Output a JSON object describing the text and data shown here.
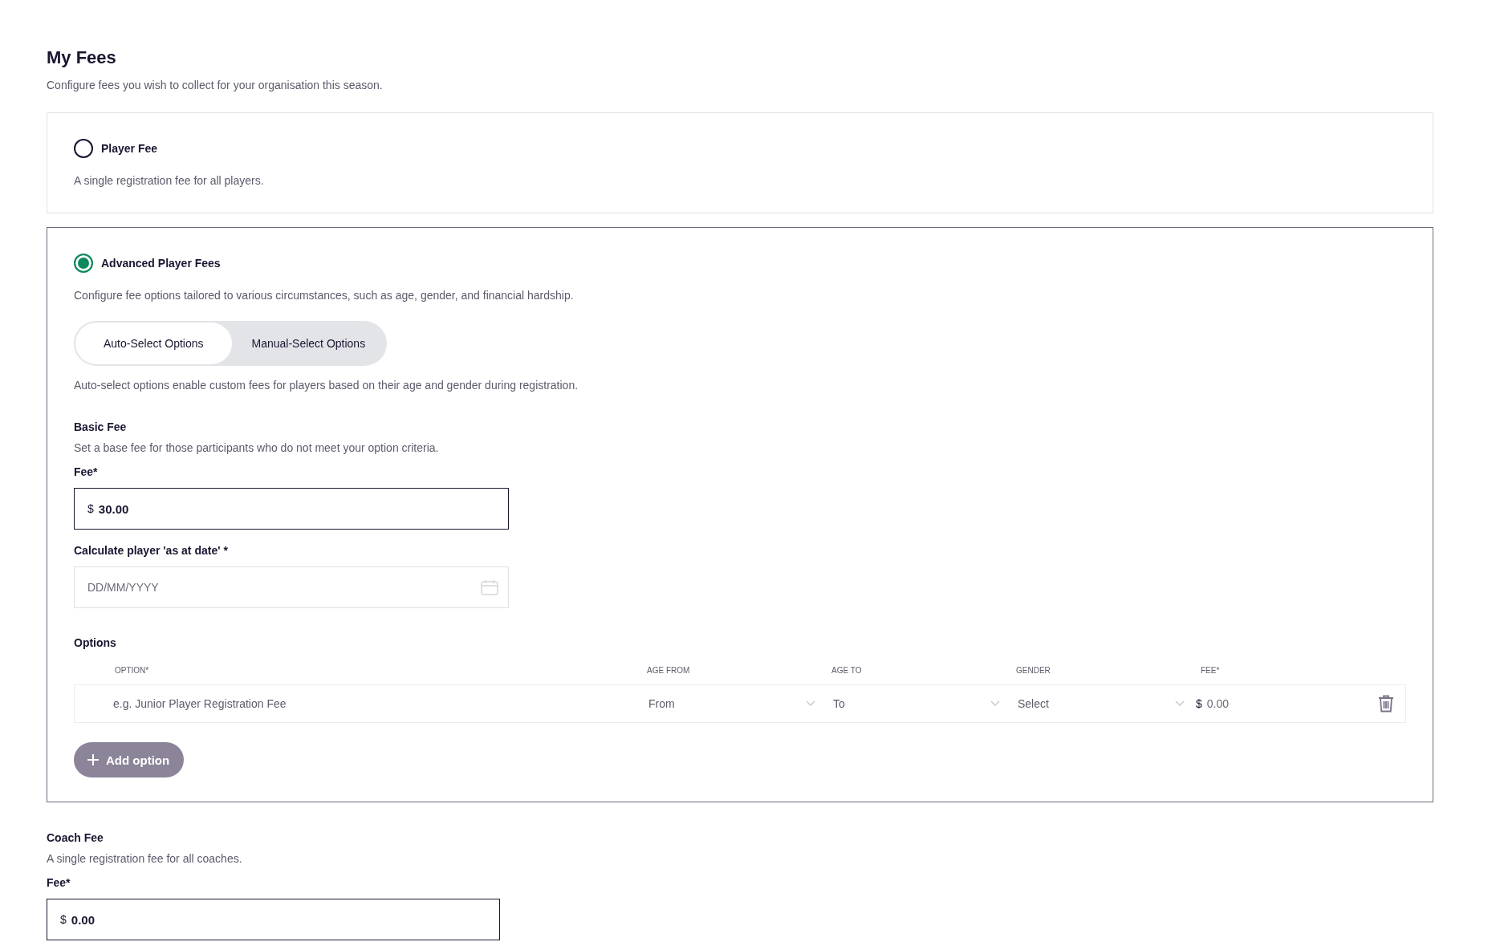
{
  "page": {
    "title": "My Fees",
    "subtitle": "Configure fees you wish to collect for your organisation this season."
  },
  "fee_types": [
    {
      "label": "Player Fee",
      "description": "A single registration fee for all players.",
      "selected": false
    },
    {
      "label": "Advanced Player Fees",
      "description": "Configure fee options tailored to various circumstances, such as age, gender, and financial hardship.",
      "selected": true
    }
  ],
  "advanced": {
    "tabs": [
      {
        "label": "Auto-Select Options",
        "selected": true
      },
      {
        "label": "Manual-Select Options",
        "selected": false
      }
    ],
    "tab_description": "Auto-select options enable custom fees for players based on their age and gender during registration.",
    "basic_fee": {
      "title": "Basic Fee",
      "description": "Set a base fee for those participants who do not meet your option criteria.",
      "label": "Fee*",
      "currency": "$",
      "value": "30.00"
    },
    "date_field": {
      "label": "Calculate player 'as at date' *",
      "placeholder": "DD/MM/YYYY"
    },
    "options": {
      "title": "Options",
      "columns": [
        "OPTION*",
        "AGE FROM",
        "AGE TO",
        "GENDER",
        "FEE*"
      ],
      "rows": [
        {
          "option_placeholder": "e.g. Junior Player Registration Fee",
          "age_from": "From",
          "age_to": "To",
          "gender": "Select",
          "currency": "$",
          "fee_placeholder": "0.00"
        }
      ],
      "add_button": "Add option"
    }
  },
  "coach_fee": {
    "title": "Coach Fee",
    "description": "A single registration fee for all coaches.",
    "label": "Fee*",
    "currency": "$",
    "value": "0.00"
  }
}
